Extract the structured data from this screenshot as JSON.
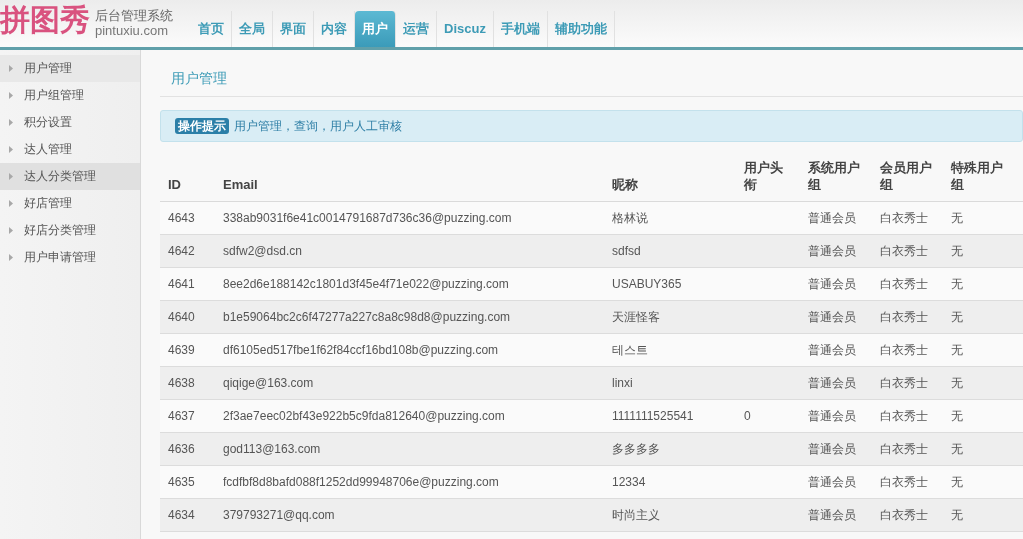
{
  "logo": {
    "brand": "拼图秀",
    "subtitle": "后台管理系统",
    "domain": "pintuxiu.com"
  },
  "nav_tabs": [
    {
      "label": "首页",
      "selected": false
    },
    {
      "label": "全局",
      "selected": false
    },
    {
      "label": "界面",
      "selected": false
    },
    {
      "label": "内容",
      "selected": false
    },
    {
      "label": "用户",
      "selected": true
    },
    {
      "label": "运营",
      "selected": false
    },
    {
      "label": "Discuz",
      "selected": false
    },
    {
      "label": "手机端",
      "selected": false
    },
    {
      "label": "辅助功能",
      "selected": false
    }
  ],
  "sidebar": {
    "items": [
      {
        "label": "用户管理",
        "selected": true,
        "hovered": false
      },
      {
        "label": "用户组管理",
        "selected": false,
        "hovered": false
      },
      {
        "label": "积分设置",
        "selected": false,
        "hovered": false
      },
      {
        "label": "达人管理",
        "selected": false,
        "hovered": false
      },
      {
        "label": "达人分类管理",
        "selected": false,
        "hovered": true
      },
      {
        "label": "好店管理",
        "selected": false,
        "hovered": false
      },
      {
        "label": "好店分类管理",
        "selected": false,
        "hovered": false
      },
      {
        "label": "用户申请管理",
        "selected": false,
        "hovered": false
      }
    ]
  },
  "page_title": "用户管理",
  "tip": {
    "badge": "操作提示",
    "text": "用户管理，查询，用户人工审核"
  },
  "table": {
    "columns": [
      "ID",
      "Email",
      "昵称",
      "用户头衔",
      "系统用户组",
      "会员用户组",
      "特殊用户组"
    ],
    "rows": [
      {
        "id": "4643",
        "email": "338ab9031f6e41c0014791687d736c36@puzzing.com",
        "nickname": "格林说",
        "system_group": "普通会员",
        "member_group": "白衣秀士",
        "special_group": "无"
      },
      {
        "id": "4642",
        "email": "sdfw2@dsd.cn",
        "nickname": "sdfsd",
        "system_group": "普通会员",
        "member_group": "白衣秀士",
        "special_group": "无"
      },
      {
        "id": "4641",
        "email": "8ee2d6e188142c1801d3f45e4f71e022@puzzing.com",
        "nickname": "USABUY365",
        "system_group": "普通会员",
        "member_group": "白衣秀士",
        "special_group": "无"
      },
      {
        "id": "4640",
        "email": "b1e59064bc2c6f47277a227c8a8c98d8@puzzing.com",
        "nickname": "天涯怪客",
        "system_group": "普通会员",
        "member_group": "白衣秀士",
        "special_group": "无"
      },
      {
        "id": "4639",
        "email": "df6105ed517fbe1f62f84ccf16bd108b@puzzing.com",
        "nickname": "테스트",
        "system_group": "普通会员",
        "member_group": "白衣秀士",
        "special_group": "无"
      },
      {
        "id": "4638",
        "email": "qiqige@163.com",
        "nickname": "linxi",
        "system_group": "普通会员",
        "member_group": "白衣秀士",
        "special_group": "无"
      },
      {
        "id": "4637",
        "email": "2f3ae7eec02bf43e922b5c9fda812640@puzzing.com",
        "nickname": "1111111525541",
        "user_title": "0",
        "system_group": "普通会员",
        "member_group": "白衣秀士",
        "special_group": "无"
      },
      {
        "id": "4636",
        "email": "god113@163.com",
        "nickname": "多多多多",
        "system_group": "普通会员",
        "member_group": "白衣秀士",
        "special_group": "无"
      },
      {
        "id": "4635",
        "email": "fcdfbf8d8bafd088f1252dd99948706e@puzzing.com",
        "nickname": "12334",
        "system_group": "普通会员",
        "member_group": "白衣秀士",
        "special_group": "无"
      },
      {
        "id": "4634",
        "email": "379793271@qq.com",
        "nickname": "时尚主义",
        "system_group": "普通会员",
        "member_group": "白衣秀士",
        "special_group": "无"
      }
    ]
  }
}
